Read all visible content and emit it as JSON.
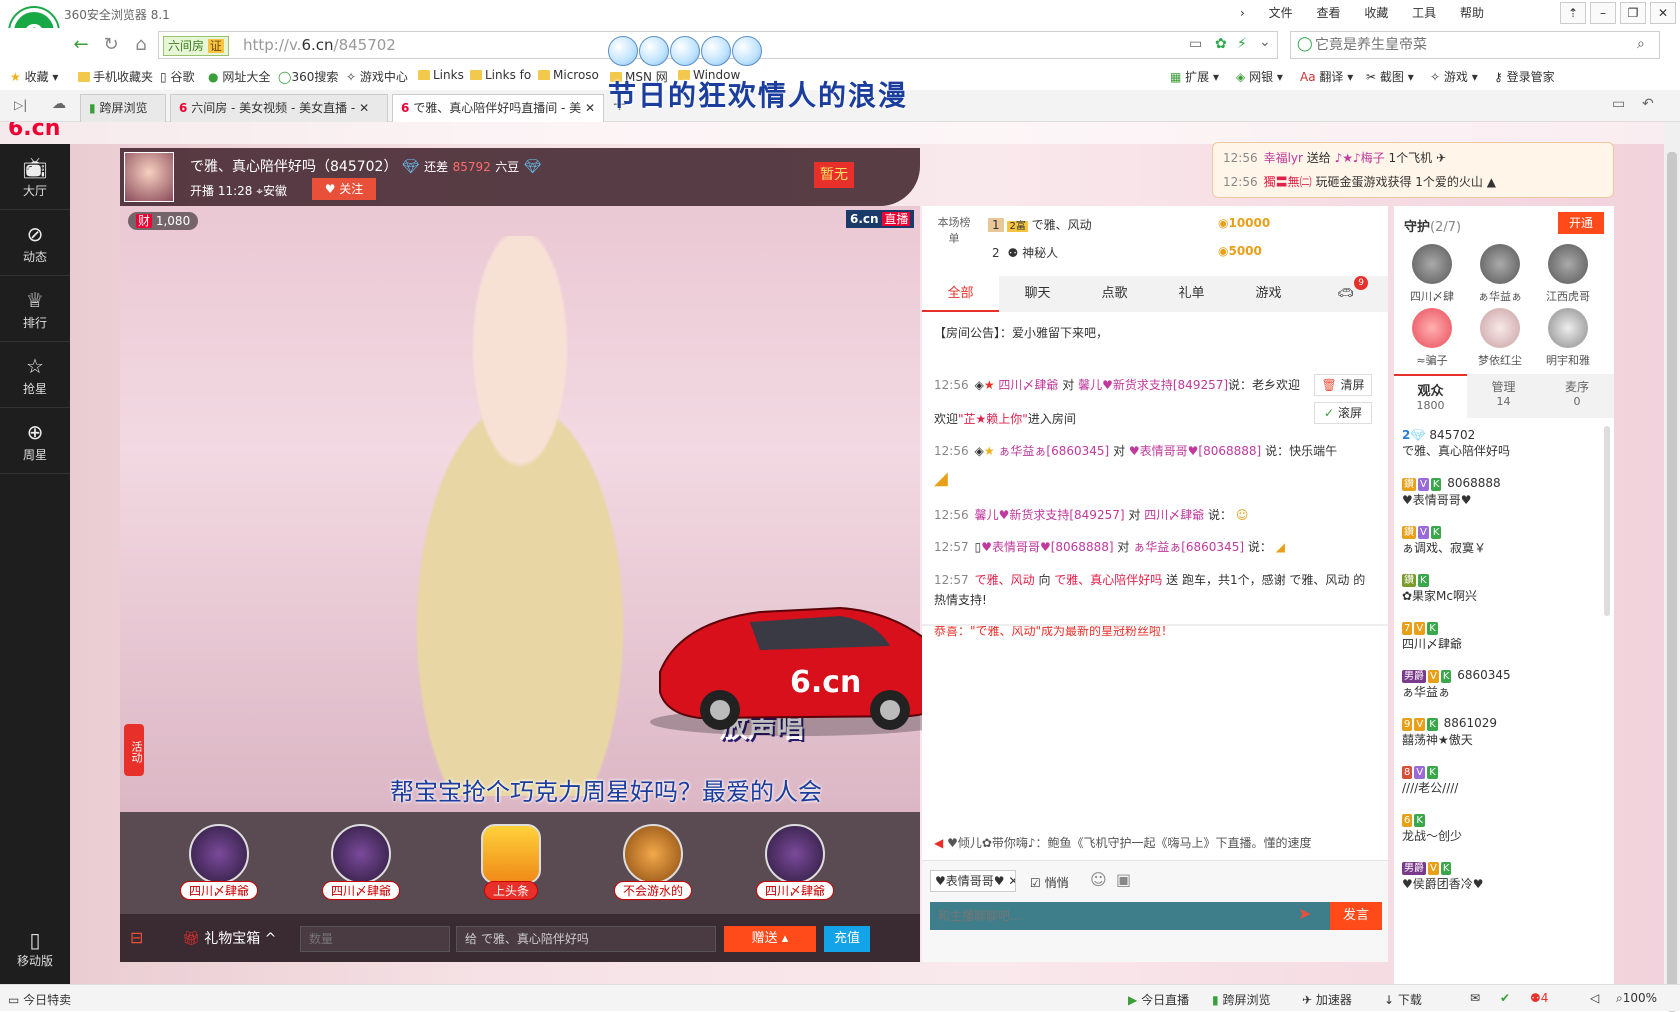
{
  "browser": {
    "title": "360安全浏览器 8.1",
    "menu": [
      "文件",
      "查看",
      "收藏",
      "工具",
      "帮助"
    ],
    "url_prefix": "http://v.",
    "url_domain": "6.cn",
    "url_path": "/845702",
    "site_badge": "六间房",
    "cert_badge": "证",
    "search_placeholder": "它竟是养生皇帝菜",
    "favorites": [
      "收藏",
      "手机收藏夹",
      "谷歌",
      "网址大全",
      "360搜索",
      "游戏中心",
      "Links",
      "Links fo",
      "Microso",
      "MSN 网",
      "Window"
    ],
    "toolbar_right": [
      "扩展",
      "网银",
      "翻译",
      "截图",
      "游戏",
      "登录管家"
    ],
    "tabs": [
      {
        "label": "跨屏浏览"
      },
      {
        "label": "六间房 - 美女视频 - 美女直播 -"
      },
      {
        "label": "で雅、真心陪伴好吗直播间 - 美"
      }
    ],
    "overlay_caption": "节日的狂欢情人的浪漫"
  },
  "leftnav": {
    "items": [
      {
        "icon": "tv-icon",
        "label": "大厅"
      },
      {
        "icon": "compass-icon",
        "label": "动态"
      },
      {
        "icon": "crown-icon",
        "label": "排行"
      },
      {
        "icon": "star-icon",
        "label": "抢星"
      },
      {
        "icon": "gift-icon",
        "label": "周星"
      }
    ],
    "mobile_label": "移动版"
  },
  "host": {
    "name": "で雅、真心陪伴好吗",
    "room_id": "（845702）",
    "need_text": "还差",
    "need_count": "85792",
    "need_unit": "六豆",
    "start_time": "开播 11:28",
    "location": "安徽",
    "follow_label": "关注",
    "flag_label": "暂无",
    "wealth": "1,080",
    "live_badge": "直播",
    "brand": "6.cn"
  },
  "video": {
    "subtitle": "帮宝宝抢个巧克力周星好吗？最爱的人会",
    "show_badge": "放声唱",
    "activity_label": "活动"
  },
  "gifts": [
    {
      "label": "四川〆肆爺"
    },
    {
      "label": "四川〆肆爺"
    },
    {
      "label": "上头条"
    },
    {
      "label": "不会游水的"
    },
    {
      "label": "四川〆肆爺"
    }
  ],
  "bottombar": {
    "giftbox_label": "礼物宝箱",
    "qty_placeholder": "数量",
    "to_prefix": "给",
    "to_name": "で雅、真心陪伴好吗",
    "send_label": "赠送",
    "recharge_label": "充值"
  },
  "notify": [
    {
      "time": "12:56",
      "user": "幸福lyr",
      "action": "送给",
      "target": "♪★♪梅子",
      "gift": "1个飞机"
    },
    {
      "time": "12:56",
      "user": "獨〓無㈡",
      "action": "玩砸金蛋游戏获得",
      "target": "",
      "gift": "1个爱的火山"
    }
  ],
  "rank": {
    "title": "本场榜单",
    "rows": [
      {
        "pos": "1",
        "name": "で雅、风动",
        "amount": "10000"
      },
      {
        "pos": "2",
        "name": "神秘人",
        "amount": "5000"
      }
    ]
  },
  "chat": {
    "tabs": [
      "全部",
      "聊天",
      "点歌",
      "礼单",
      "游戏"
    ],
    "car_count": "9",
    "announcement": "【房间公告】：爱小雅留下来吧，",
    "clear_label": "清屏",
    "scroll_label": "滚屏",
    "messages": [
      {
        "time": "12:56",
        "from": "四川〆肆爺",
        "mid": "对",
        "to": "馨儿♥新货求支持[849257]",
        "text": "说：老乡欢迎"
      },
      {
        "time": "",
        "from": "",
        "mid": "欢迎",
        "to": "\"芷★赖上你\"",
        "text": "进入房间"
      },
      {
        "time": "12:56",
        "from": "ぁ华益ぁ[6860345]",
        "mid": "对",
        "to": "♥表情哥哥♥[8068888]",
        "text": "说：快乐端午"
      },
      {
        "time": "12:56",
        "from": "馨儿♥新货求支持[849257]",
        "mid": "对",
        "to": "四川〆肆爺",
        "text": "说："
      },
      {
        "time": "12:57",
        "from": "♥表情哥哥♥[8068888]",
        "mid": "对",
        "to": "ぁ华益ぁ[6860345]",
        "text": "说："
      },
      {
        "time": "12:57",
        "from": "で雅、风动",
        "mid": "向",
        "to": "で雅、真心陪伴好吗",
        "text": "送 跑车，共1个，感谢 で雅、风动 的热情支持!"
      },
      {
        "time": "",
        "from": "",
        "mid": "",
        "to": "",
        "text": "恭喜：\"で雅、风动\"成为最新的皇冠粉丝啦！"
      }
    ],
    "ticker": "♥倾儿✿带你嗨♪：鲍鱼《飞机守护一起《嗨马上》下直播。懂的速度",
    "target_user": "♥表情哥哥♥",
    "whisper_label": "悄悄",
    "input_placeholder": "和主播聊聊吧...",
    "send_label": "发言"
  },
  "guards": {
    "title": "守护",
    "count": "(2/7)",
    "open_label": "开通",
    "members": [
      "四川〆肆",
      "ぁ华益ぁ",
      "江西虎哥",
      "≈骗子",
      "梦依红尘",
      "明宇和雅"
    ]
  },
  "audience": {
    "tabs": [
      {
        "label": "观众",
        "count": "1800"
      },
      {
        "label": "管理",
        "count": "14"
      },
      {
        "label": "麦序",
        "count": "0"
      }
    ],
    "list": [
      {
        "id": "845702",
        "name": "で雅、真心陪伴好吗",
        "level": "2"
      },
      {
        "id": "8068888",
        "name": "♥表情哥哥♥",
        "level": "鑽"
      },
      {
        "id": "",
        "name": "ぁ调戏、寂寞￥",
        "level": "鑽"
      },
      {
        "id": "",
        "name": "✿果家Mc啊兴",
        "level": "鑽"
      },
      {
        "id": "",
        "name": "四川〆肆爺",
        "level": "7"
      },
      {
        "id": "6860345",
        "name": "ぁ华益ぁ",
        "level": "男爵"
      },
      {
        "id": "8861029",
        "name": "囍荡神★傲天",
        "level": "9"
      },
      {
        "id": "",
        "name": "////老公////",
        "level": "8"
      },
      {
        "id": "",
        "name": "龙战～创少",
        "level": "6"
      },
      {
        "id": "",
        "name": "♥侯爵团香冷♥",
        "level": "男爵"
      }
    ]
  },
  "status": {
    "left": "今日特卖",
    "items": [
      "今日直播",
      "跨屏浏览",
      "加速器",
      "下载"
    ],
    "zoom": "100%",
    "msg_count": "4"
  }
}
